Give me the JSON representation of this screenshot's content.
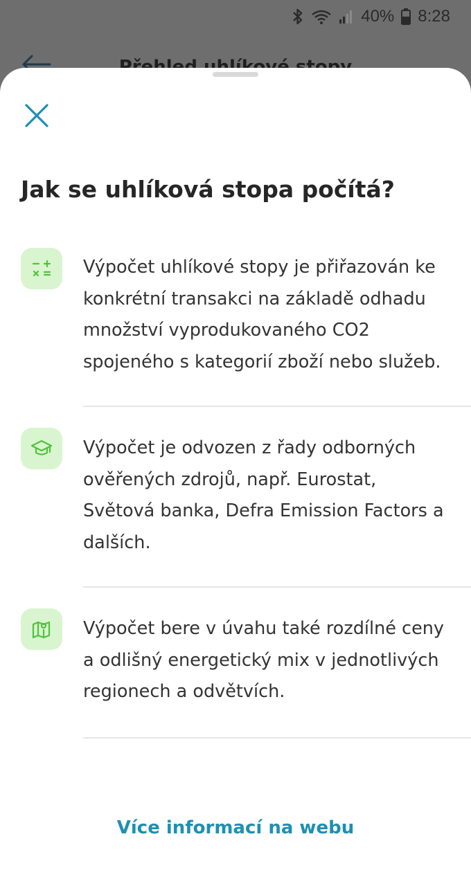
{
  "status_bar": {
    "battery_percent": "40%",
    "time": "8:28",
    "icons": [
      "bluetooth-icon",
      "wifi-icon",
      "signal-icon",
      "battery-icon"
    ]
  },
  "background_screen": {
    "back_icon": "arrow-left-icon",
    "title": "Přehled uhlíkové stopy"
  },
  "sheet": {
    "close_icon": "close-icon",
    "title": "Jak se uhlíková stopa počítá?",
    "items": [
      {
        "icon": "calculator-icon",
        "text": "Výpočet uhlíkové stopy je přiřazován ke konkrétní transakci na základě odhadu množství vyprodukovaného CO2 spojeného s kategorií zboží nebo služeb."
      },
      {
        "icon": "graduation-cap-icon",
        "text": "Výpočet je odvozen z řady odborných ověřených zdrojů, např. Eurostat, Světová banka, Defra Emission Factors a dalších."
      },
      {
        "icon": "map-pin-icon",
        "text": "Výpočet bere v úvahu také rozdílné ceny a odlišný energetický mix v jednotlivých regionech a odvětvích."
      }
    ],
    "more_link": "Více informací na webu"
  },
  "colors": {
    "accent": "#1e8fb3",
    "icon_bg": "#d8f5cf",
    "icon_fg": "#4fc23a",
    "overlay": "#6e6e6e"
  }
}
